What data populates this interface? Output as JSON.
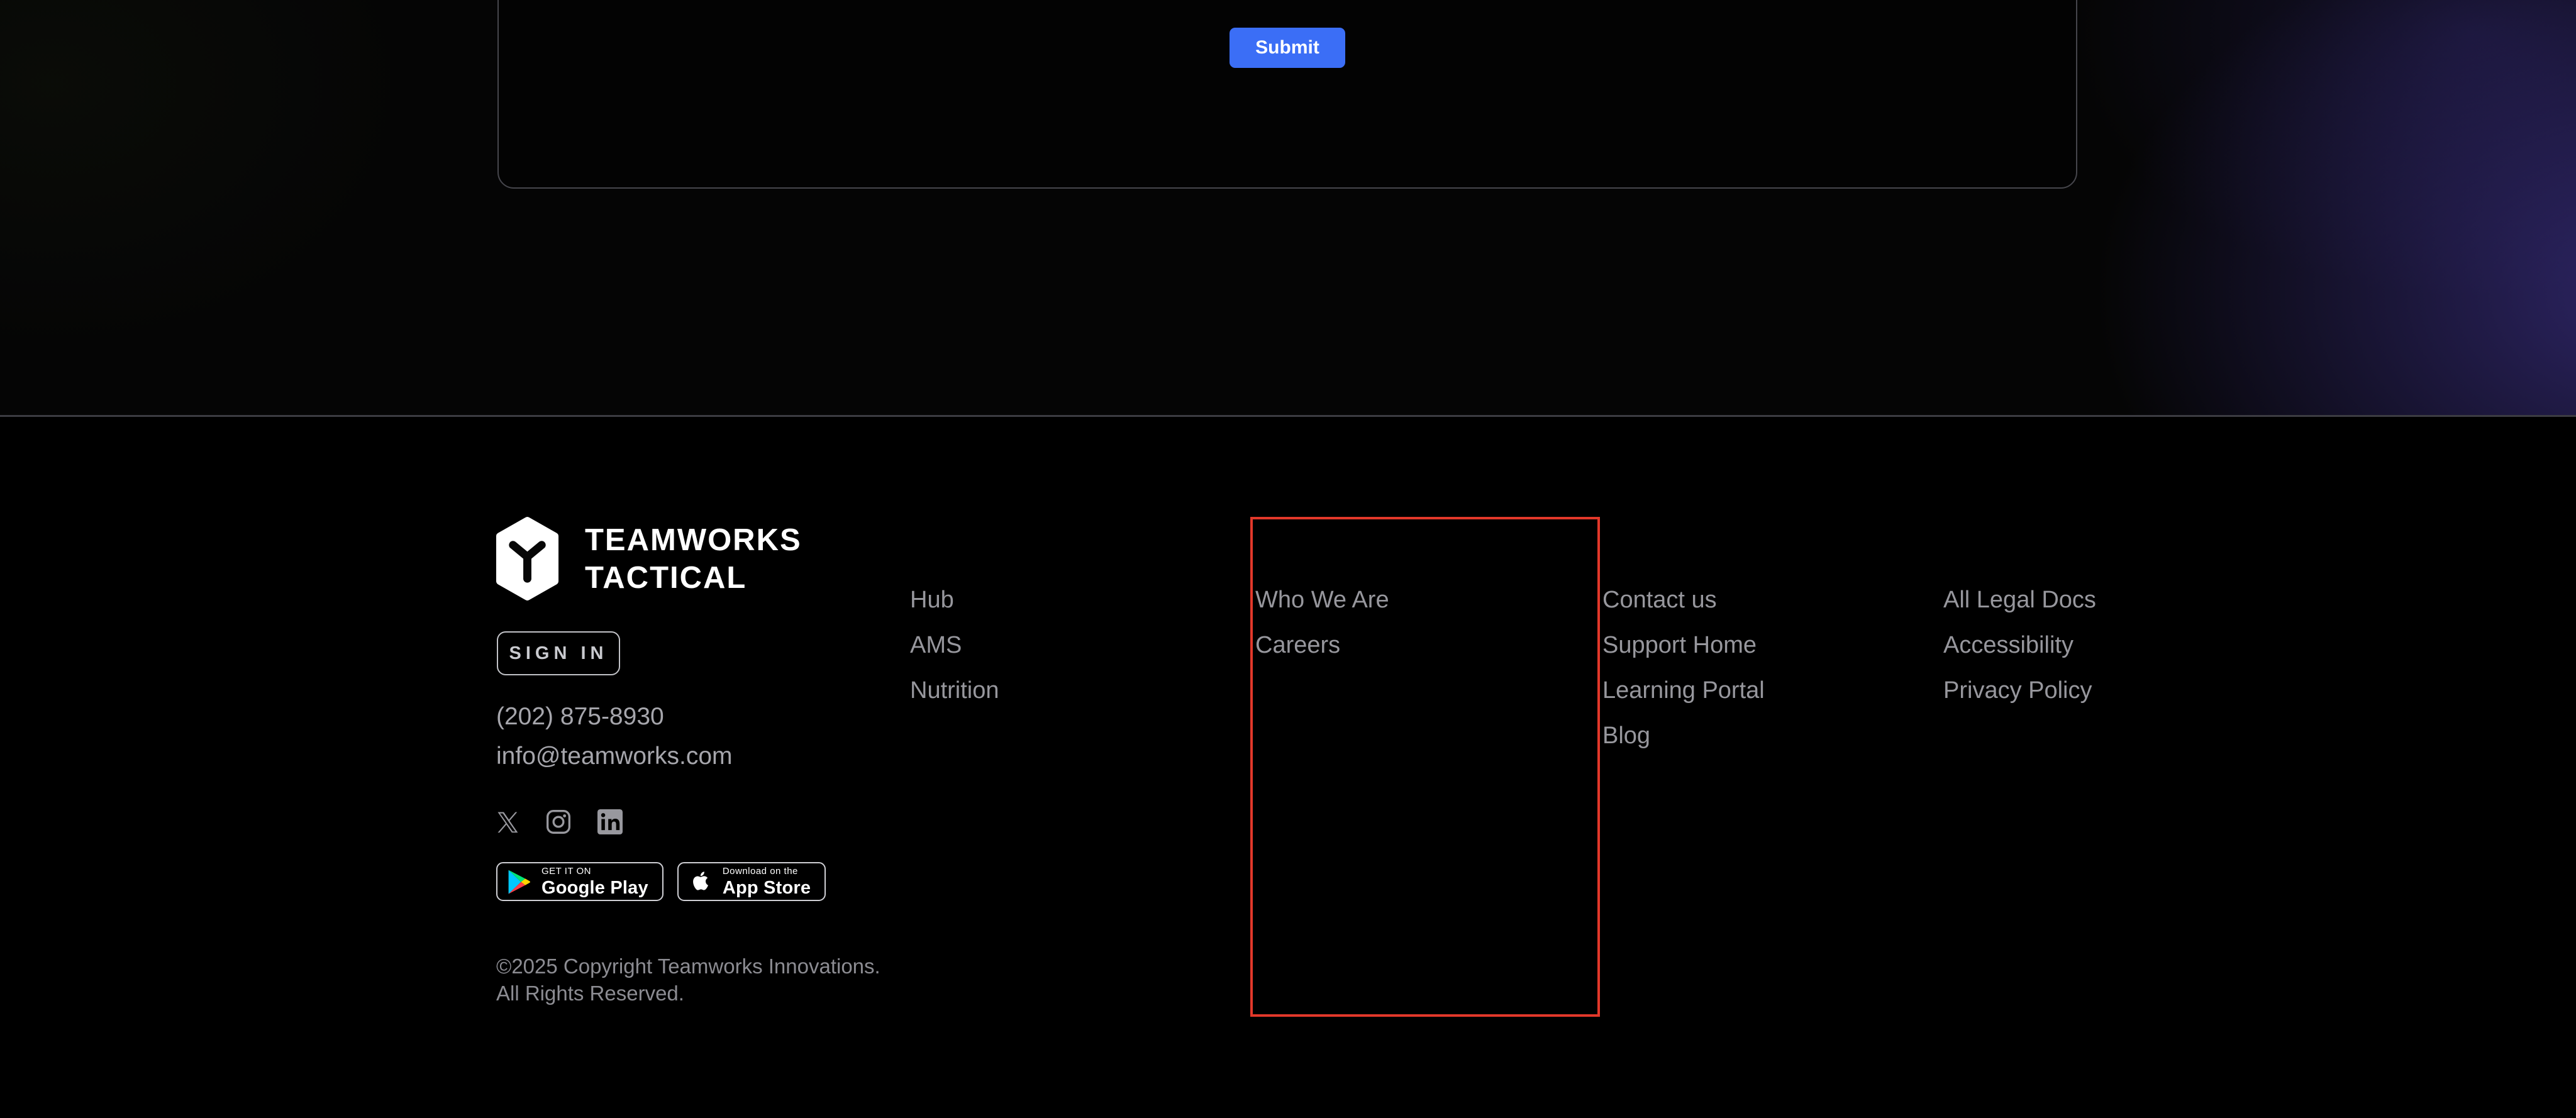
{
  "hero": {
    "submit_label": "Submit"
  },
  "footer": {
    "brand": {
      "logo_icon": "teamworks-hexagon-y-logo",
      "name_line1": "TEAMWORKS",
      "name_line2": "TACTICAL"
    },
    "sign_in_label": "SIGN IN",
    "contact": {
      "phone": "(202) 875-8930",
      "email": "info@teamworks.com"
    },
    "social_icons": [
      "x",
      "instagram",
      "linkedin"
    ],
    "badges": {
      "google_play": {
        "top": "GET IT ON",
        "bottom": "Google Play"
      },
      "app_store": {
        "top": "Download on the",
        "bottom": "App Store"
      }
    },
    "copyright_line1": "©2025 Copyright Teamworks Innovations.",
    "copyright_line2": "All Rights Reserved.",
    "nav_columns": [
      {
        "items": [
          {
            "label": "Hub"
          },
          {
            "label": "AMS"
          },
          {
            "label": "Nutrition"
          }
        ]
      },
      {
        "items": [
          {
            "label": "Who We Are"
          },
          {
            "label": "Careers"
          }
        ],
        "highlighted": true
      },
      {
        "items": [
          {
            "label": "Contact us"
          },
          {
            "label": "Support Home"
          },
          {
            "label": "Learning Portal"
          },
          {
            "label": "Blog"
          }
        ]
      },
      {
        "items": [
          {
            "label": "All Legal Docs"
          },
          {
            "label": "Accessibility"
          },
          {
            "label": "Privacy Policy"
          }
        ]
      }
    ]
  },
  "colors": {
    "accent_blue": "#3b6ef6",
    "highlight_red": "#e2382a",
    "card_border": "#46464c",
    "divider": "#3c3c42",
    "link_gray": "#97979d",
    "contact_gray": "#a6a6ac",
    "copyright_gray": "#8c8c92",
    "signin_border": "#c2c3c8",
    "signin_text": "#c9cacf",
    "icon_gray": "#98989e",
    "white": "#ffffff",
    "footer_bg": "#000000",
    "hero_bg": "#050505"
  }
}
